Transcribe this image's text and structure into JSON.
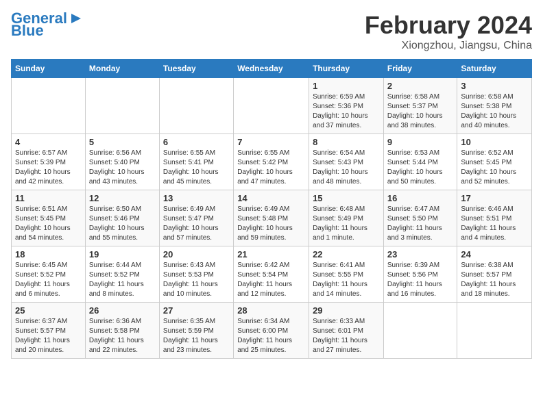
{
  "header": {
    "logo_line1": "General",
    "logo_line2": "Blue",
    "title": "February 2024",
    "subtitle": "Xiongzhou, Jiangsu, China"
  },
  "weekdays": [
    "Sunday",
    "Monday",
    "Tuesday",
    "Wednesday",
    "Thursday",
    "Friday",
    "Saturday"
  ],
  "weeks": [
    [
      {
        "day": "",
        "info": ""
      },
      {
        "day": "",
        "info": ""
      },
      {
        "day": "",
        "info": ""
      },
      {
        "day": "",
        "info": ""
      },
      {
        "day": "1",
        "info": "Sunrise: 6:59 AM\nSunset: 5:36 PM\nDaylight: 10 hours\nand 37 minutes."
      },
      {
        "day": "2",
        "info": "Sunrise: 6:58 AM\nSunset: 5:37 PM\nDaylight: 10 hours\nand 38 minutes."
      },
      {
        "day": "3",
        "info": "Sunrise: 6:58 AM\nSunset: 5:38 PM\nDaylight: 10 hours\nand 40 minutes."
      }
    ],
    [
      {
        "day": "4",
        "info": "Sunrise: 6:57 AM\nSunset: 5:39 PM\nDaylight: 10 hours\nand 42 minutes."
      },
      {
        "day": "5",
        "info": "Sunrise: 6:56 AM\nSunset: 5:40 PM\nDaylight: 10 hours\nand 43 minutes."
      },
      {
        "day": "6",
        "info": "Sunrise: 6:55 AM\nSunset: 5:41 PM\nDaylight: 10 hours\nand 45 minutes."
      },
      {
        "day": "7",
        "info": "Sunrise: 6:55 AM\nSunset: 5:42 PM\nDaylight: 10 hours\nand 47 minutes."
      },
      {
        "day": "8",
        "info": "Sunrise: 6:54 AM\nSunset: 5:43 PM\nDaylight: 10 hours\nand 48 minutes."
      },
      {
        "day": "9",
        "info": "Sunrise: 6:53 AM\nSunset: 5:44 PM\nDaylight: 10 hours\nand 50 minutes."
      },
      {
        "day": "10",
        "info": "Sunrise: 6:52 AM\nSunset: 5:45 PM\nDaylight: 10 hours\nand 52 minutes."
      }
    ],
    [
      {
        "day": "11",
        "info": "Sunrise: 6:51 AM\nSunset: 5:45 PM\nDaylight: 10 hours\nand 54 minutes."
      },
      {
        "day": "12",
        "info": "Sunrise: 6:50 AM\nSunset: 5:46 PM\nDaylight: 10 hours\nand 55 minutes."
      },
      {
        "day": "13",
        "info": "Sunrise: 6:49 AM\nSunset: 5:47 PM\nDaylight: 10 hours\nand 57 minutes."
      },
      {
        "day": "14",
        "info": "Sunrise: 6:49 AM\nSunset: 5:48 PM\nDaylight: 10 hours\nand 59 minutes."
      },
      {
        "day": "15",
        "info": "Sunrise: 6:48 AM\nSunset: 5:49 PM\nDaylight: 11 hours\nand 1 minute."
      },
      {
        "day": "16",
        "info": "Sunrise: 6:47 AM\nSunset: 5:50 PM\nDaylight: 11 hours\nand 3 minutes."
      },
      {
        "day": "17",
        "info": "Sunrise: 6:46 AM\nSunset: 5:51 PM\nDaylight: 11 hours\nand 4 minutes."
      }
    ],
    [
      {
        "day": "18",
        "info": "Sunrise: 6:45 AM\nSunset: 5:52 PM\nDaylight: 11 hours\nand 6 minutes."
      },
      {
        "day": "19",
        "info": "Sunrise: 6:44 AM\nSunset: 5:52 PM\nDaylight: 11 hours\nand 8 minutes."
      },
      {
        "day": "20",
        "info": "Sunrise: 6:43 AM\nSunset: 5:53 PM\nDaylight: 11 hours\nand 10 minutes."
      },
      {
        "day": "21",
        "info": "Sunrise: 6:42 AM\nSunset: 5:54 PM\nDaylight: 11 hours\nand 12 minutes."
      },
      {
        "day": "22",
        "info": "Sunrise: 6:41 AM\nSunset: 5:55 PM\nDaylight: 11 hours\nand 14 minutes."
      },
      {
        "day": "23",
        "info": "Sunrise: 6:39 AM\nSunset: 5:56 PM\nDaylight: 11 hours\nand 16 minutes."
      },
      {
        "day": "24",
        "info": "Sunrise: 6:38 AM\nSunset: 5:57 PM\nDaylight: 11 hours\nand 18 minutes."
      }
    ],
    [
      {
        "day": "25",
        "info": "Sunrise: 6:37 AM\nSunset: 5:57 PM\nDaylight: 11 hours\nand 20 minutes."
      },
      {
        "day": "26",
        "info": "Sunrise: 6:36 AM\nSunset: 5:58 PM\nDaylight: 11 hours\nand 22 minutes."
      },
      {
        "day": "27",
        "info": "Sunrise: 6:35 AM\nSunset: 5:59 PM\nDaylight: 11 hours\nand 23 minutes."
      },
      {
        "day": "28",
        "info": "Sunrise: 6:34 AM\nSunset: 6:00 PM\nDaylight: 11 hours\nand 25 minutes."
      },
      {
        "day": "29",
        "info": "Sunrise: 6:33 AM\nSunset: 6:01 PM\nDaylight: 11 hours\nand 27 minutes."
      },
      {
        "day": "",
        "info": ""
      },
      {
        "day": "",
        "info": ""
      }
    ]
  ]
}
